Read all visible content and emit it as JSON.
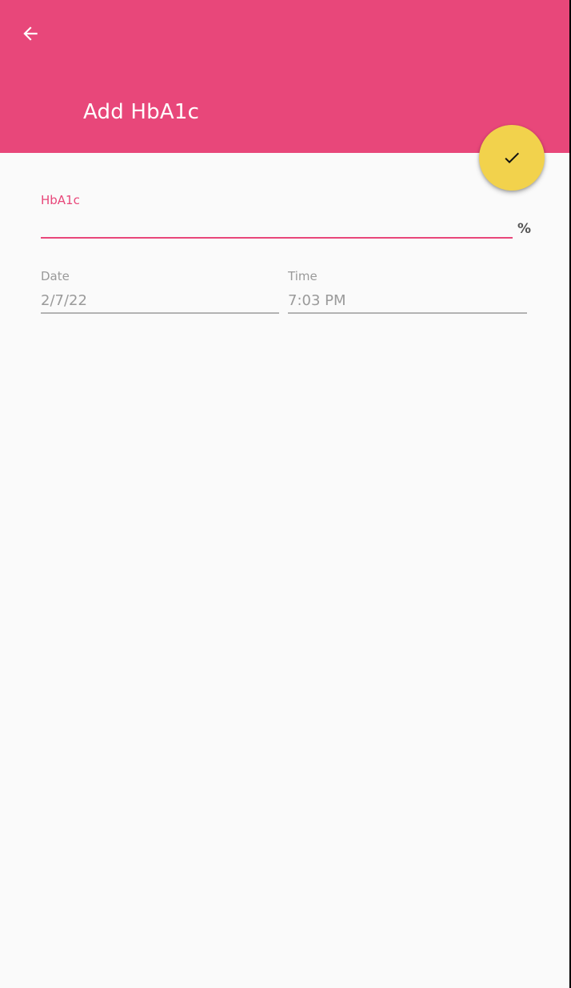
{
  "app_bar": {
    "title": "Add HbA1c",
    "back_icon": "arrow-back-icon",
    "background_color": "#e8477a"
  },
  "fab": {
    "icon": "check-icon",
    "color": "#f2d24c"
  },
  "form": {
    "hba1c": {
      "label": "HbA1c",
      "value": "",
      "unit": "%",
      "accent_color": "#e8477a"
    },
    "date": {
      "label": "Date",
      "value": "2/7/22"
    },
    "time": {
      "label": "Time",
      "value": "7:03 PM"
    }
  }
}
